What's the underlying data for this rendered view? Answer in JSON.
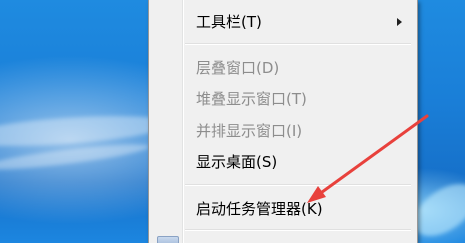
{
  "context_menu": {
    "items": [
      {
        "label": "工具栏(T)",
        "enabled": true,
        "has_submenu": true
      },
      {
        "label": "层叠窗口(D)",
        "enabled": false
      },
      {
        "label": "堆叠显示窗口(T)",
        "enabled": false
      },
      {
        "label": "并排显示窗口(I)",
        "enabled": false
      },
      {
        "label": "显示桌面(S)",
        "enabled": true
      },
      {
        "label": "启动任务管理器(K)",
        "enabled": true
      }
    ]
  },
  "annotation": {
    "arrow_color": "#e8413c"
  },
  "colors": {
    "desktop_blue": "#1a7fd8",
    "menu_background": "#f0f0f0",
    "disabled_text": "#8d8d8d"
  }
}
